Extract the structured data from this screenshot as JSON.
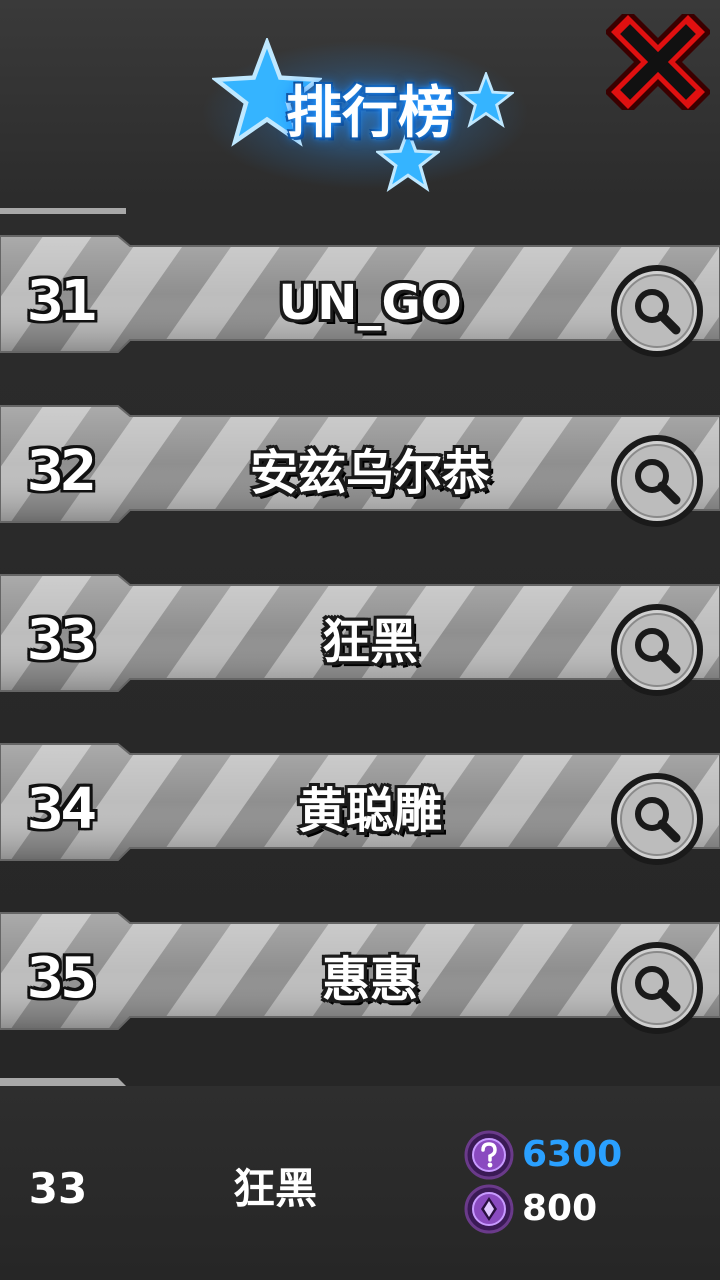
{
  "header": {
    "title": "排行榜",
    "close_icon": "close-x-icon",
    "accent": "#2aa0ff",
    "close_color": "#e01010"
  },
  "leaderboard": {
    "rows": [
      {
        "rank": "31",
        "name": "UN_GO"
      },
      {
        "rank": "32",
        "name": "安兹乌尔恭"
      },
      {
        "rank": "33",
        "name": "狂黑"
      },
      {
        "rank": "34",
        "name": "黄聪雕"
      },
      {
        "rank": "35",
        "name": "惠惠"
      }
    ],
    "search_icon": "magnifier-icon"
  },
  "footer": {
    "rank": "33",
    "name": "狂黑",
    "score": "6300",
    "score_color": "#2aa0ff",
    "secondary": "800",
    "secondary_color": "#ffffff",
    "score_icon": "purple-medal-icon",
    "secondary_icon": "purple-gem-icon"
  }
}
